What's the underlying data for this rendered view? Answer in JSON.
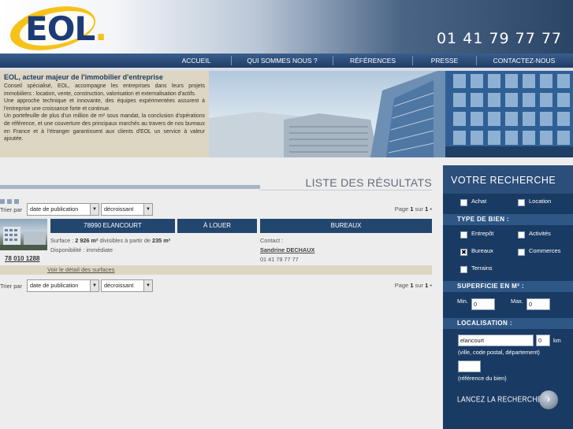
{
  "header": {
    "logo_text": "EOL",
    "logo_dot": ".",
    "phone": "01 41 79 77 77"
  },
  "nav": {
    "items": [
      {
        "label": "ACCUEIL"
      },
      {
        "label": "QUI SOMMES NOUS ?"
      },
      {
        "label": "RÉFÉRENCES"
      },
      {
        "label": "PRESSE"
      },
      {
        "label": "CONTACTEZ-NOUS"
      }
    ]
  },
  "intro": {
    "title": "EOL, acteur majeur de l'immobilier d'entreprise",
    "p1": "Conseil spécialisé, EOL, accompagne les entreprises dans leurs projets immobiliers : location, vente, construction, valorisation et externalisation d'actifs.",
    "p2": "Une approche technique et innovante, des équipes expérimentées assurent à l'entreprise une croissance forte et continue.",
    "p3": "Un portefeuille de plus d'un million de m² sous mandat, la conclusion d'opérations de référence, et une couverture des principaux marchés au travers de nos bureaux en France et à l'étranger garantissent aux clients d'EOL un service à valeur ajoutée."
  },
  "results": {
    "title": "LISTE DES RÉSULTATS",
    "sort_label": "Trier par",
    "sort_field": "date de publication",
    "sort_order": "décroissant",
    "pager_prefix": "Page",
    "pager_current": "1",
    "pager_mid": "sur",
    "pager_total": "1",
    "pager_suffix": "•",
    "item": {
      "location": "78990 ELANCOURT",
      "transaction": "À LOUER",
      "type": "BUREAUX",
      "surface_prefix": "Surface :",
      "surface_value": "2 926 m²",
      "surface_mid": "divisibles à partir de",
      "surface_min": "235 m²",
      "availability": "Disponibilité : immédiate",
      "contact_label": "Contact :",
      "contact_name": "Sandrine DECHAUX",
      "contact_phone": "01 41 79 77 77",
      "reference": "78 010 1288",
      "detail_link": "Voir le détail des surfaces"
    }
  },
  "search": {
    "title": "VOTRE RECHERCHE",
    "checkbox_mark": "✖",
    "transaction": [
      {
        "label": "Achat",
        "checked": false
      },
      {
        "label": "Location",
        "checked": false
      }
    ],
    "type_title": "TYPE DE BIEN :",
    "types": [
      {
        "label": "Entrepôt",
        "checked": false
      },
      {
        "label": "Activités",
        "checked": false
      },
      {
        "label": "Bureaux",
        "checked": true
      },
      {
        "label": "Commerces",
        "checked": false
      },
      {
        "label": "Terrains",
        "checked": false
      }
    ],
    "surface_title": "SUPERFICIE EN M² :",
    "min_label": "Min.",
    "min_value": "0",
    "max_label": "Max.",
    "max_value": "0",
    "loc_title": "LOCALISATION :",
    "city_value": "elancourt",
    "km_value": "0",
    "km_label": "km",
    "city_hint": "(ville, code postal, département)",
    "ref_value": "",
    "ref_hint": "(référence du bien)",
    "launch_label": "LANCEZ LA RECHERCHE",
    "launch_icon": "›"
  },
  "colors": {
    "navy": "#193a63",
    "nav": "#23466e",
    "beige": "#ddd6c2",
    "accent": "#f6c21a"
  }
}
